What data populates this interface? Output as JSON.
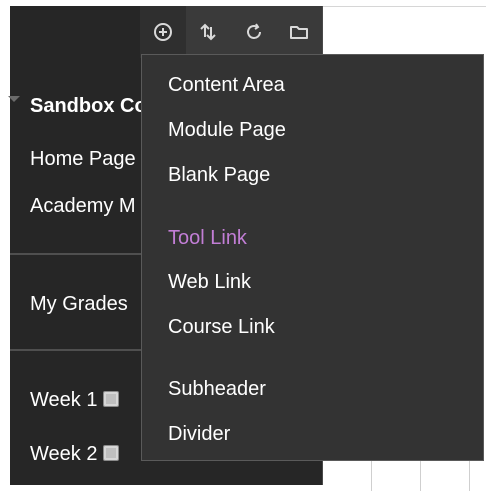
{
  "toolbar": {
    "buttons": [
      {
        "name": "add-menu-item",
        "icon": "plus-circle-icon"
      },
      {
        "name": "reorder",
        "icon": "up-down-arrows-icon"
      },
      {
        "name": "refresh",
        "icon": "refresh-icon"
      },
      {
        "name": "folder",
        "icon": "folder-icon"
      }
    ]
  },
  "sidebar": {
    "course_title": "Sandbox Co",
    "items": [
      {
        "label": "Home Page"
      },
      {
        "label": "Academy M"
      },
      {
        "label": "My Grades"
      },
      {
        "label": "Week 1"
      },
      {
        "label": "Week 2"
      }
    ]
  },
  "dropdown": {
    "items": [
      {
        "label": "Content Area"
      },
      {
        "label": "Module Page"
      },
      {
        "label": "Blank Page"
      },
      {
        "label": "Tool Link"
      },
      {
        "label": "Web Link"
      },
      {
        "label": "Course Link"
      },
      {
        "label": "Subheader"
      },
      {
        "label": "Divider"
      }
    ],
    "highlight_color": "#c27ed6"
  },
  "colors": {
    "sidebar_bg": "#262626",
    "toolbar_bg": "#3a3a3a",
    "dropdown_bg": "#333333",
    "text": "#ffffff"
  }
}
